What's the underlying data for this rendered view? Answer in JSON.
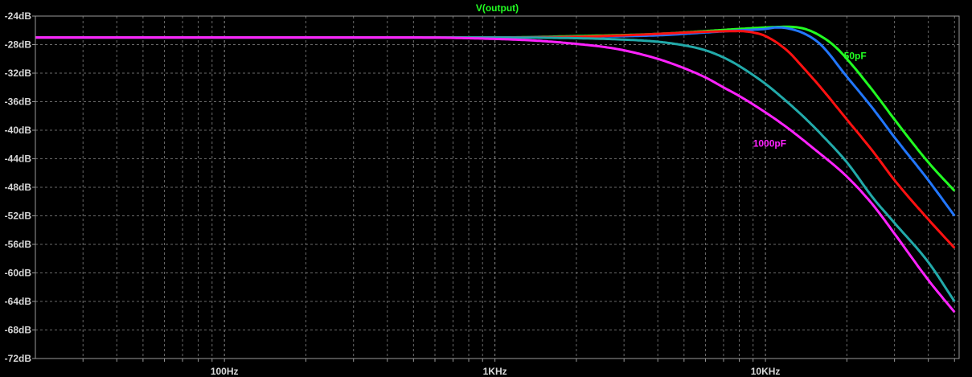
{
  "chart_data": {
    "type": "line",
    "title": "V(output)",
    "title_color": "#22ff22",
    "x_scale": "log",
    "x_unit": "Hz",
    "xlim": [
      20,
      52000
    ],
    "ylim": [
      -72,
      -24
    ],
    "y_unit": "dB",
    "grid": true,
    "grid_style": "dashed",
    "y_ticks": [
      -24,
      -28,
      -32,
      -36,
      -40,
      -44,
      -48,
      -52,
      -56,
      -60,
      -64,
      -68,
      -72
    ],
    "y_tick_labels": [
      "-24dB",
      "-28dB",
      "-32dB",
      "-36dB",
      "-40dB",
      "-44dB",
      "-48dB",
      "-52dB",
      "-56dB",
      "-60dB",
      "-64dB",
      "-68dB",
      "-72dB"
    ],
    "x_ticks": [
      100,
      1000,
      10000
    ],
    "x_tick_labels": [
      "100Hz",
      "1KHz",
      "10KHz"
    ],
    "series": [
      {
        "color": "#22ff22",
        "x": [
          20,
          1000,
          2000,
          4000,
          6000,
          8000,
          10000,
          12000,
          14000,
          16000,
          18000,
          20000,
          25000,
          30000,
          40000,
          50000
        ],
        "y": [
          -27.0,
          -27.0,
          -26.8,
          -26.5,
          -26.1,
          -25.8,
          -25.6,
          -25.5,
          -25.8,
          -26.8,
          -28.2,
          -30.0,
          -34.5,
          -38.5,
          -44.5,
          -48.5
        ]
      },
      {
        "color": "#2277ff",
        "x": [
          20,
          1000,
          2000,
          4000,
          6000,
          8000,
          10000,
          11000,
          12000,
          14000,
          16000,
          20000,
          25000,
          30000,
          40000,
          50000
        ],
        "y": [
          -27.0,
          -27.0,
          -26.9,
          -26.7,
          -26.3,
          -26.0,
          -25.8,
          -25.6,
          -25.7,
          -26.5,
          -28.0,
          -32.5,
          -37.0,
          -41.0,
          -47.0,
          -52.0
        ]
      },
      {
        "color": "#ff1111",
        "x": [
          20,
          1000,
          2000,
          3000,
          4000,
          6000,
          8000,
          9000,
          10000,
          12000,
          14000,
          16000,
          20000,
          25000,
          30000,
          40000,
          50000
        ],
        "y": [
          -27.0,
          -27.0,
          -26.9,
          -26.7,
          -26.5,
          -26.2,
          -26.1,
          -26.3,
          -26.8,
          -28.8,
          -31.5,
          -34.0,
          -38.5,
          -43.0,
          -47.0,
          -52.5,
          -56.5
        ]
      },
      {
        "color": "#22aaaa",
        "x": [
          20,
          1000,
          2000,
          3000,
          4000,
          5000,
          6000,
          7000,
          8000,
          10000,
          12000,
          14000,
          16000,
          20000,
          25000,
          30000,
          40000,
          50000
        ],
        "y": [
          -27.0,
          -27.0,
          -27.1,
          -27.3,
          -27.6,
          -28.1,
          -28.8,
          -29.8,
          -31.0,
          -33.5,
          -36.0,
          -38.3,
          -40.5,
          -44.5,
          -49.5,
          -53.0,
          -58.5,
          -64.0
        ]
      },
      {
        "color": "#ff22ff",
        "x": [
          20,
          500,
          1000,
          1500,
          2000,
          2500,
          3000,
          4000,
          5000,
          6000,
          7000,
          8000,
          10000,
          12000,
          15000,
          20000,
          25000,
          30000,
          40000,
          50000
        ],
        "y": [
          -27.0,
          -27.0,
          -27.2,
          -27.5,
          -27.9,
          -28.3,
          -28.8,
          -30.0,
          -31.3,
          -32.6,
          -34.0,
          -35.2,
          -37.5,
          -39.6,
          -42.5,
          -46.5,
          -50.5,
          -54.5,
          -61.0,
          -65.5
        ]
      }
    ],
    "annotations": [
      {
        "text": "50pF",
        "color": "#22ff22",
        "x": 19500,
        "y": -30.0
      },
      {
        "text": "1000pF",
        "color": "#ff22ff",
        "x": 9000,
        "y": -42.3
      }
    ]
  }
}
